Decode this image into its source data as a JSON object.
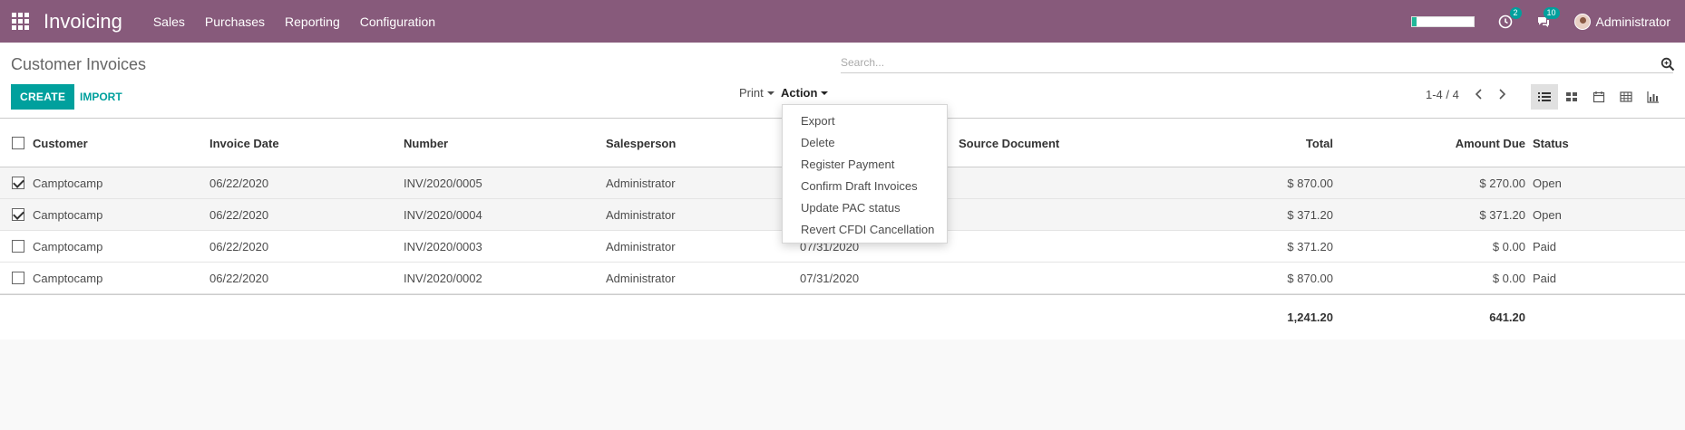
{
  "navbar": {
    "app_title": "Invoicing",
    "menu": [
      "Sales",
      "Purchases",
      "Reporting",
      "Configuration"
    ],
    "activity_badge": "2",
    "messages_badge": "10",
    "user_name": "Administrator",
    "icons": {
      "apps": "apps-grid-icon",
      "activity": "clock-icon",
      "messages": "chat-icon"
    },
    "accent_color": "#875A7B"
  },
  "control": {
    "breadcrumb": "Customer Invoices",
    "search_placeholder": "Search...",
    "create_label": "CREATE",
    "import_label": "IMPORT",
    "print_label": "Print",
    "action_label": "Action",
    "pager": "1-4 / 4",
    "views": [
      "list",
      "kanban",
      "calendar",
      "pivot",
      "graph"
    ],
    "active_view": "list",
    "primary_color": "#00A09D"
  },
  "action_menu": [
    "Export",
    "Delete",
    "Register Payment",
    "Confirm Draft Invoices",
    "Update PAC status",
    "Revert CFDI Cancellation"
  ],
  "table": {
    "columns": {
      "customer": "Customer",
      "invoice_date": "Invoice Date",
      "number": "Number",
      "salesperson": "Salesperson",
      "due_date": "",
      "source_document": "Source Document",
      "total": "Total",
      "amount_due": "Amount Due",
      "status": "Status"
    },
    "rows": [
      {
        "checked": true,
        "customer": "Camptocamp",
        "invoice_date": "06/22/2020",
        "number": "INV/2020/0005",
        "salesperson": "Administrator",
        "due_date": "",
        "source_document": "",
        "total": "$ 870.00",
        "amount_due": "$ 270.00",
        "status": "Open"
      },
      {
        "checked": true,
        "customer": "Camptocamp",
        "invoice_date": "06/22/2020",
        "number": "INV/2020/0004",
        "salesperson": "Administrator",
        "due_date": "",
        "source_document": "",
        "total": "$ 371.20",
        "amount_due": "$ 371.20",
        "status": "Open"
      },
      {
        "checked": false,
        "customer": "Camptocamp",
        "invoice_date": "06/22/2020",
        "number": "INV/2020/0003",
        "salesperson": "Administrator",
        "due_date": "07/31/2020",
        "source_document": "",
        "total": "$ 371.20",
        "amount_due": "$ 0.00",
        "status": "Paid"
      },
      {
        "checked": false,
        "customer": "Camptocamp",
        "invoice_date": "06/22/2020",
        "number": "INV/2020/0002",
        "salesperson": "Administrator",
        "due_date": "07/31/2020",
        "source_document": "",
        "total": "$ 870.00",
        "amount_due": "$ 0.00",
        "status": "Paid"
      }
    ],
    "footer": {
      "total": "1,241.20",
      "amount_due": "641.20"
    }
  }
}
